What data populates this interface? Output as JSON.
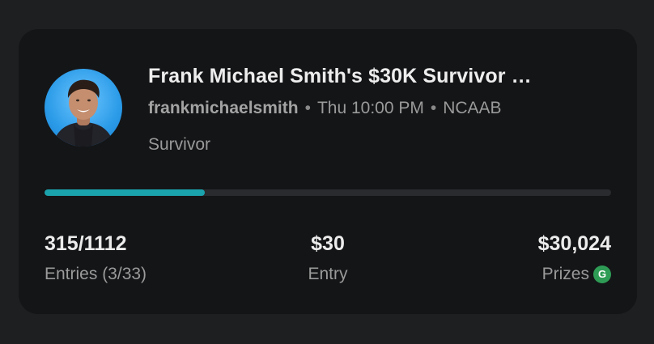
{
  "contest": {
    "title": "Frank Michael Smith's $30K Survivor …",
    "host_username": "frankmichaelsmith",
    "start_time": "Thu 10:00 PM",
    "league": "NCAAB",
    "format": "Survivor",
    "separator": "•"
  },
  "progress": {
    "fraction": 0.283,
    "fill_color": "#1ba3ad"
  },
  "stats": {
    "entries_value": "315/1112",
    "entries_label": "Entries (3/33)",
    "entry_fee_value": "$30",
    "entry_fee_label": "Entry",
    "prizes_value": "$30,024",
    "prizes_label": "Prizes",
    "guaranteed_badge": "G",
    "guaranteed_badge_color": "#2e9c55"
  },
  "avatar": {
    "icon": "user-avatar-photo",
    "background_color": "#2b9be8"
  }
}
